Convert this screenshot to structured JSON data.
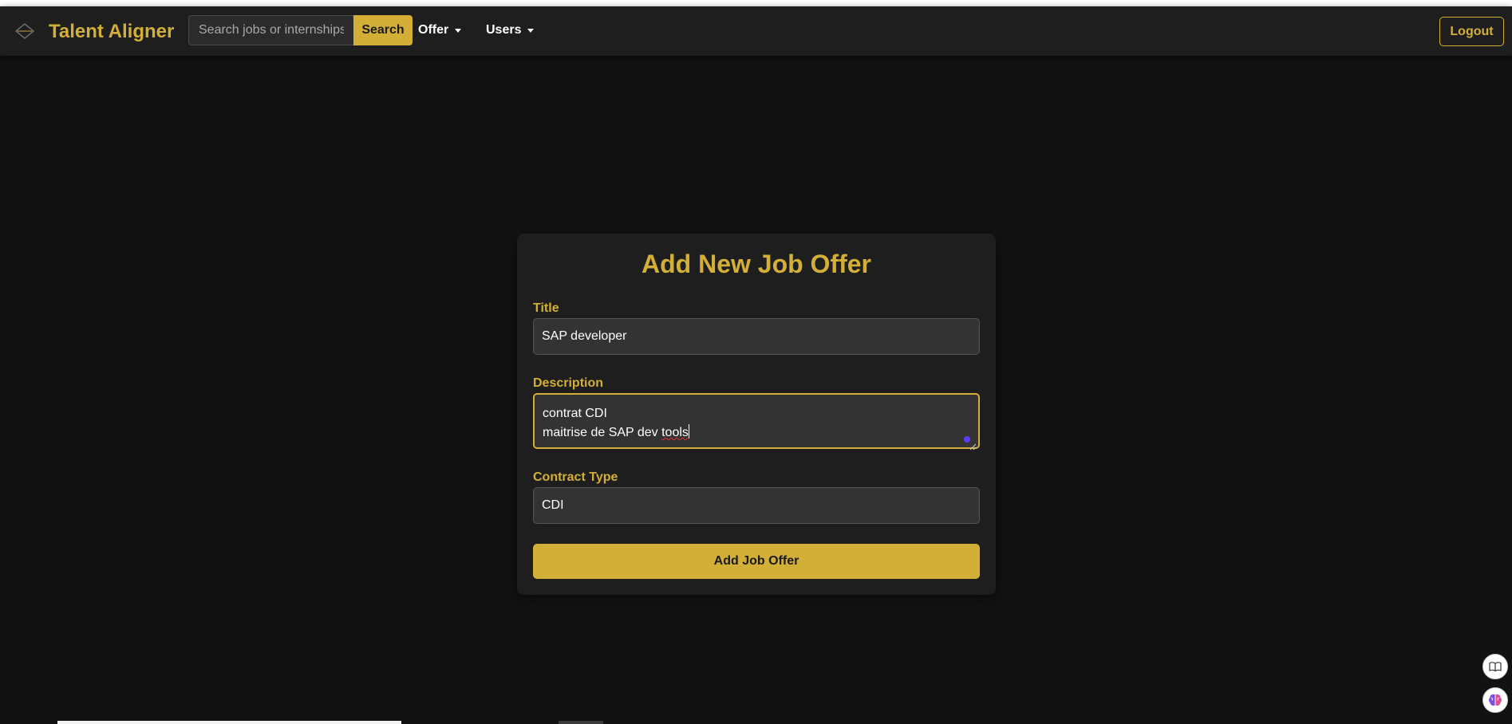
{
  "app": {
    "brand": "Talent Aligner",
    "logo_icon": "talent-aligner-logo-icon"
  },
  "navbar": {
    "search": {
      "placeholder": "Search jobs or internships",
      "value": "",
      "button_label": "Search"
    },
    "menus": [
      {
        "label": "Offer",
        "icon": "chevron-down-icon"
      },
      {
        "label": "Users",
        "icon": "chevron-down-icon"
      }
    ],
    "logout_label": "Logout"
  },
  "form": {
    "title": "Add New Job Offer",
    "fields": {
      "title": {
        "label": "Title",
        "value": "SAP developer"
      },
      "description": {
        "label": "Description",
        "lines": [
          "contrat CDI",
          "maitrise de SAP dev "
        ],
        "misspelled_word": "tools"
      },
      "contract_type": {
        "label": "Contract Type",
        "value": "CDI"
      }
    },
    "submit_label": "Add Job Offer"
  },
  "side_widgets": [
    {
      "icon": "book-icon"
    },
    {
      "icon": "brain-icon"
    }
  ],
  "colors": {
    "accent": "#d4af37",
    "background": "#121212",
    "surface": "#1e1e1e",
    "input": "#333333"
  }
}
